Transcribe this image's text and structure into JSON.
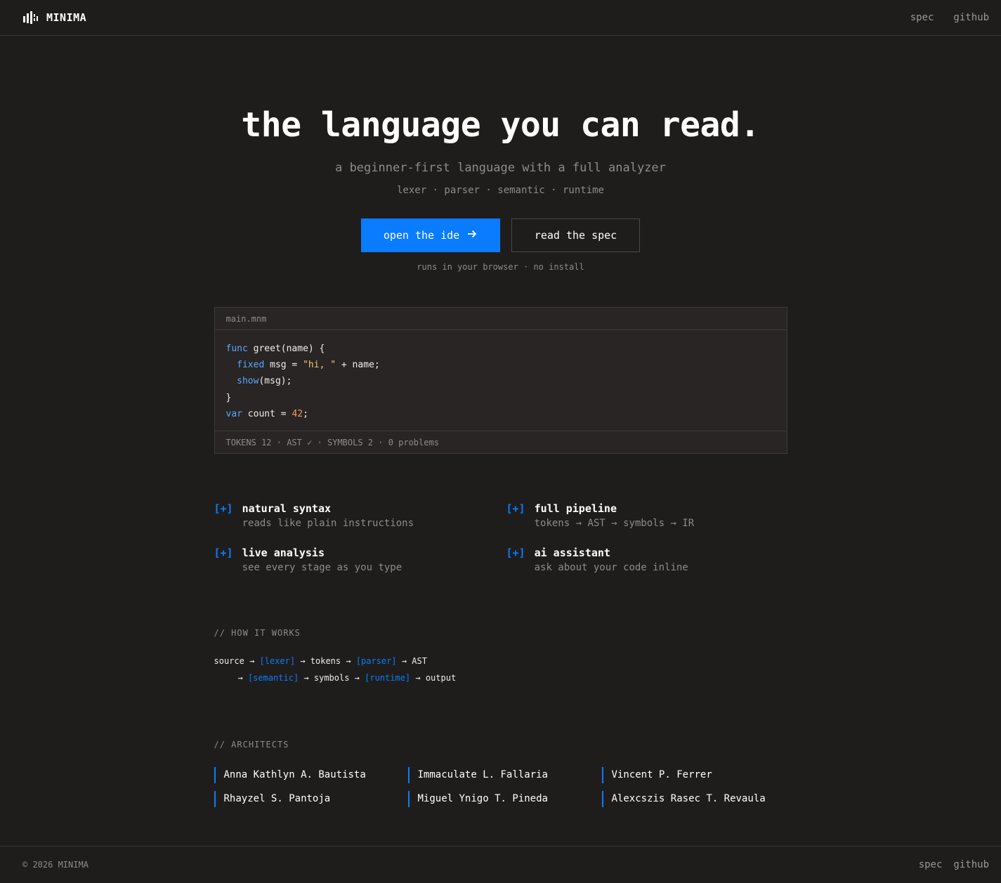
{
  "brand": {
    "name": "MINIMA",
    "logo_icon": "bars-logo-icon"
  },
  "nav": {
    "spec": "spec",
    "github": "github"
  },
  "hero": {
    "title": "the language you can read.",
    "subtitle": "a beginner-first language with a full analyzer",
    "stages": "lexer · parser · semantic · runtime",
    "primary_cta": "open the ide",
    "primary_cta_icon": "arrow-right-icon",
    "secondary_cta": "read the spec",
    "note": "runs in your browser · no install"
  },
  "editor": {
    "filename": "main.mnm",
    "code": {
      "l1_kw": "func",
      "l1_rest": " greet(name) {",
      "l2_indent": "  ",
      "l2_kw": "fixed",
      "l2_mid": " msg = ",
      "l2_str": "\"hi, \"",
      "l2_rest": " + name;",
      "l3_indent": "  ",
      "l3_kw": "show",
      "l3_rest": "(msg);",
      "l4": "}",
      "l5_kw": "var",
      "l5_mid": " count = ",
      "l5_num": "42",
      "l5_rest": ";"
    },
    "status": "TOKENS 12 · AST ✓ · SYMBOLS 2 · 0 problems"
  },
  "features": [
    {
      "marker": "[+]",
      "title": "natural syntax",
      "desc": "reads like plain instructions"
    },
    {
      "marker": "[+]",
      "title": "full pipeline",
      "desc": "tokens → AST → symbols → IR"
    },
    {
      "marker": "[+]",
      "title": "live analysis",
      "desc": "see every stage as you type"
    },
    {
      "marker": "[+]",
      "title": "ai assistant",
      "desc": "ask about your code inline"
    }
  ],
  "how": {
    "label": "// HOW IT WORKS",
    "line1": {
      "a": "source → ",
      "b": "[lexer]",
      "c": " → tokens → ",
      "d": "[parser]",
      "e": " → AST"
    },
    "line2": {
      "a": "→ ",
      "b": "[semantic]",
      "c": " → symbols → ",
      "d": "[runtime]",
      "e": " → output"
    }
  },
  "architects": {
    "label": "// ARCHITECTS",
    "names": [
      "Anna Kathlyn A. Bautista",
      "Immaculate L. Fallaria",
      "Vincent P. Ferrer",
      "Rhayzel S. Pantoja",
      "Miguel Ynigo T. Pineda",
      "Alexcszis Rasec T. Revaula"
    ]
  },
  "footer": {
    "copyright": "© 2026 MINIMA",
    "spec": "spec",
    "github": "github"
  },
  "colors": {
    "accent": "#0a7cff",
    "background": "#1f1d1c",
    "panel": "#282524",
    "keyword": "#5aa6ff",
    "string": "#f3c27d",
    "number": "#f09a5a"
  }
}
